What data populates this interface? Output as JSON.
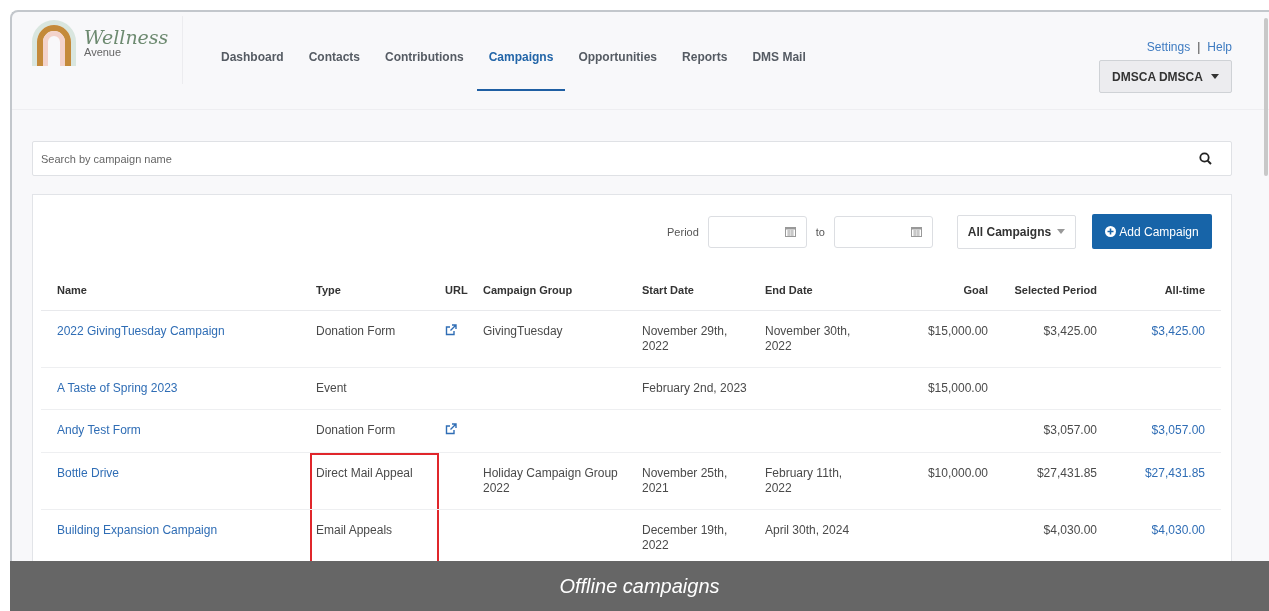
{
  "logo": {
    "title": "Wellness",
    "subtitle": "Avenue"
  },
  "nav": [
    {
      "label": "Dashboard",
      "selected": false
    },
    {
      "label": "Contacts",
      "selected": false
    },
    {
      "label": "Contributions",
      "selected": false
    },
    {
      "label": "Campaigns",
      "selected": true
    },
    {
      "label": "Opportunities",
      "selected": false
    },
    {
      "label": "Reports",
      "selected": false
    },
    {
      "label": "DMS Mail",
      "selected": false
    }
  ],
  "top_links": [
    "Settings",
    "Help"
  ],
  "top_links_separator": "|",
  "user_menu": {
    "label": "DMSCA DMSCA"
  },
  "search": {
    "placeholder": "Search by campaign name"
  },
  "filters": {
    "period_label": "Period",
    "to_label": "to",
    "campaign_filter": "All Campaigns",
    "add_button": "Add Campaign"
  },
  "table": {
    "columns": [
      "Name",
      "Type",
      "URL",
      "Campaign Group",
      "Start Date",
      "End Date",
      "Goal",
      "Selected Period",
      "All-time"
    ],
    "rows": [
      {
        "name": "2022 GivingTuesday Campaign",
        "type": "Donation Form",
        "url": true,
        "group": "GivingTuesday",
        "start": "November 29th, 2022",
        "end": "November 30th, 2022",
        "goal": "$15,000.00",
        "selected_period": "$3,425.00",
        "all_time": "$3,425.00",
        "highlighted": false
      },
      {
        "name": "A Taste of Spring 2023",
        "type": "Event",
        "url": false,
        "start": "February 2nd, 2023",
        "goal": "$15,000.00",
        "highlighted": false
      },
      {
        "name": "Andy Test Form",
        "type": "Donation Form",
        "url": true,
        "selected_period": "$3,057.00",
        "all_time": "$3,057.00",
        "highlighted": false
      },
      {
        "name": "Bottle Drive",
        "type": "Direct Mail Appeal",
        "url": false,
        "group": "Holiday Campaign Group 2022",
        "start": "November 25th, 2021",
        "end": "February 11th, 2022",
        "goal": "$10,000.00",
        "selected_period": "$27,431.85",
        "all_time": "$27,431.85",
        "highlighted": true
      },
      {
        "name": "Building Expansion Campaign",
        "type": "Email Appeals",
        "url": false,
        "start": "December 19th, 2022",
        "end": "April 30th, 2024",
        "selected_period": "$4,030.00",
        "all_time": "$4,030.00",
        "highlighted": true
      }
    ]
  },
  "caption": "Offline campaigns"
}
